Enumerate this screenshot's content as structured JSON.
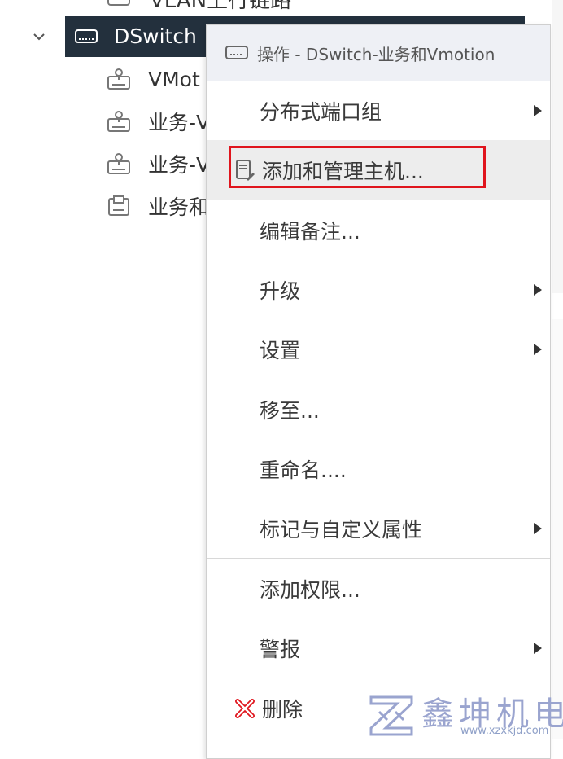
{
  "tree": {
    "top_clipped_label": "VLAN上行链路",
    "selected": {
      "label": "DSwitch"
    },
    "children": [
      {
        "label": "VMot",
        "icon": "portgroup-icon"
      },
      {
        "label": "业务-V",
        "icon": "portgroup-icon"
      },
      {
        "label": "业务-V",
        "icon": "portgroup-icon"
      },
      {
        "label": "业务和",
        "icon": "uplink-icon"
      }
    ]
  },
  "menu": {
    "header": "操作 - DSwitch-业务和Vmotion",
    "items": [
      {
        "label": "分布式端口组",
        "submenu": true
      },
      {
        "label": "添加和管理主机...",
        "submenu": false,
        "highlighted": true
      },
      {
        "label": "编辑备注...",
        "submenu": false
      },
      {
        "label": "升级",
        "submenu": true
      },
      {
        "label": "设置",
        "submenu": true
      },
      {
        "label": "移至...",
        "submenu": false
      },
      {
        "label": "重命名....",
        "submenu": false
      },
      {
        "label": "标记与自定义属性",
        "submenu": true
      },
      {
        "label": "添加权限...",
        "submenu": false
      },
      {
        "label": "警报",
        "submenu": true
      },
      {
        "label": "删除",
        "submenu": false
      }
    ]
  },
  "colors": {
    "selected_row": "#23303d",
    "highlight": "#e0151d",
    "delete_icon": "#e0151d",
    "watermark": "#9aa4cf"
  },
  "watermark": {
    "text": "鑫坤机电",
    "url": "www.xzxkjd.com"
  }
}
